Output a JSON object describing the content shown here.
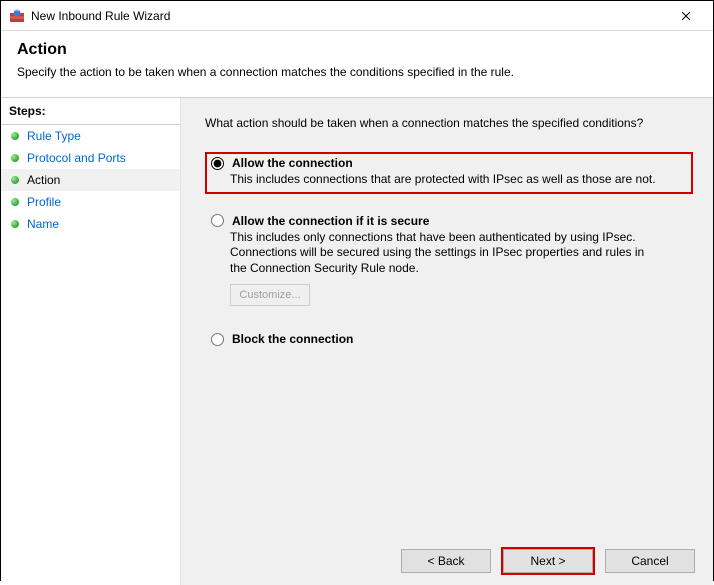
{
  "window": {
    "title": "New Inbound Rule Wizard"
  },
  "header": {
    "title": "Action",
    "subtitle": "Specify the action to be taken when a connection matches the conditions specified in the rule."
  },
  "sidebar": {
    "title": "Steps:",
    "items": [
      {
        "label": "Rule Type"
      },
      {
        "label": "Protocol and Ports"
      },
      {
        "label": "Action"
      },
      {
        "label": "Profile"
      },
      {
        "label": "Name"
      }
    ]
  },
  "content": {
    "question": "What action should be taken when a connection matches the specified conditions?",
    "options": {
      "allow": {
        "title": "Allow the connection",
        "desc": "This includes connections that are protected with IPsec as well as those are not."
      },
      "allow_secure": {
        "title": "Allow the connection if it is secure",
        "desc": "This includes only connections that have been authenticated by using IPsec. Connections will be secured using the settings in IPsec properties and rules in the Connection Security Rule node.",
        "customize": "Customize..."
      },
      "block": {
        "title": "Block the connection"
      }
    }
  },
  "buttons": {
    "back": "< Back",
    "next": "Next >",
    "cancel": "Cancel"
  }
}
